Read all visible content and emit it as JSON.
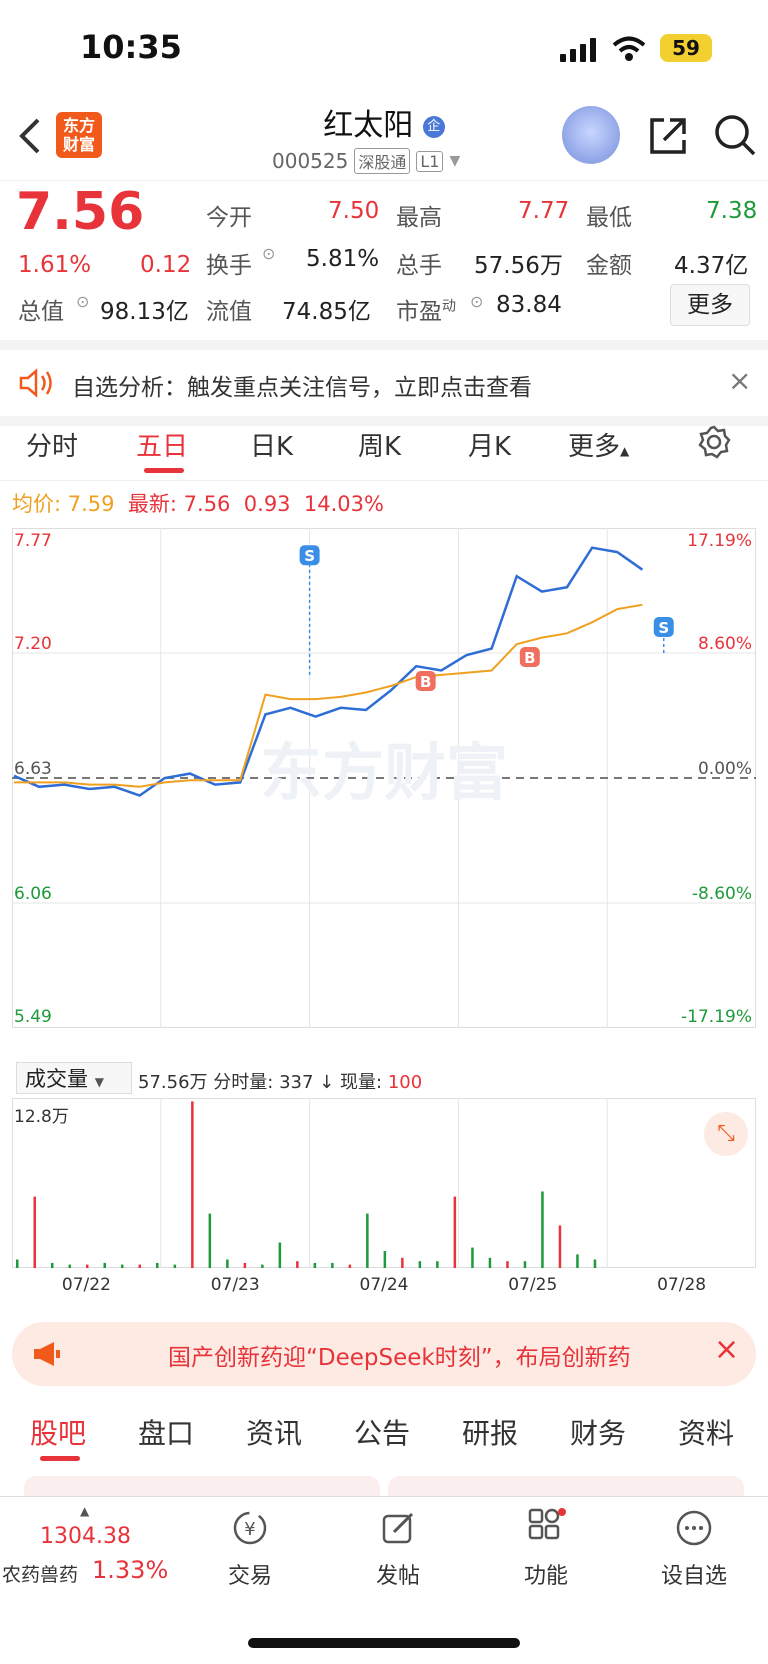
{
  "status": {
    "time": "10:35",
    "battery": "59"
  },
  "header": {
    "logo_text": "东方\n财富",
    "name": "红太阳",
    "code": "000525",
    "tag1": "深股通",
    "tag2": "L1"
  },
  "quote": {
    "price": "7.56",
    "pct": "1.61%",
    "chg": "0.12",
    "open_label": "今开",
    "open": "7.50",
    "high_label": "最高",
    "high": "7.77",
    "low_label": "最低",
    "low": "7.38",
    "turnover_label": "换手",
    "turnover": "5.81%",
    "vol_label": "总手",
    "vol": "57.56万",
    "amount_label": "金额",
    "amount": "4.37亿",
    "mktcap_label": "总值",
    "mktcap": "98.13亿",
    "float_label": "流值",
    "float": "74.85亿",
    "pe_label": "市盈",
    "pe_sup": "动",
    "pe": "83.84",
    "more": "更多"
  },
  "banner": {
    "text": "自选分析：触发重点关注信号，立即点击查看"
  },
  "tabs": [
    "分时",
    "五日",
    "日K",
    "周K",
    "月K",
    "更多"
  ],
  "info": {
    "avg_label": "均价:",
    "avg": "7.59",
    "last_label": "最新:",
    "last": "7.56",
    "chg": "0.93",
    "pct": "14.03%"
  },
  "chart_data": {
    "type": "line",
    "x": [
      "07/22",
      "07/23",
      "07/24",
      "07/25",
      "07/28"
    ],
    "ylim": [
      5.49,
      7.77
    ],
    "y_ticks": [
      "7.77",
      "7.20",
      "6.63",
      "6.06",
      "5.49"
    ],
    "pct_ticks": [
      "17.19%",
      "8.60%",
      "0.00%",
      "-8.60%",
      "-17.19%"
    ],
    "series": [
      {
        "values": [
          6.64,
          6.59,
          6.6,
          6.58,
          6.59,
          6.55,
          6.63,
          6.65,
          6.6,
          6.61,
          6.92,
          6.95,
          6.91,
          6.95,
          6.94,
          7.03,
          7.14,
          7.12,
          7.19,
          7.22,
          7.55,
          7.48,
          7.5,
          7.68,
          7.66,
          7.58
        ]
      },
      {
        "values": [
          6.61,
          6.61,
          6.61,
          6.6,
          6.6,
          6.59,
          6.61,
          6.62,
          6.62,
          6.62,
          7.01,
          6.99,
          6.99,
          7.0,
          7.02,
          7.05,
          7.09,
          7.1,
          7.11,
          7.12,
          7.24,
          7.27,
          7.29,
          7.34,
          7.4,
          7.42
        ]
      }
    ],
    "signals": [
      {
        "type": "B",
        "day": "07/24"
      },
      {
        "type": "S",
        "day": "07/24"
      },
      {
        "type": "B",
        "day": "07/25"
      },
      {
        "type": "S",
        "day": "07/28"
      }
    ],
    "watermark": "东方财富"
  },
  "volume": {
    "label": "成交量",
    "total": "57.56万",
    "fsl_label": "分时量:",
    "fsl": "337",
    "xl_label": "现量:",
    "xl": "100",
    "max": "12.8万"
  },
  "ad": {
    "text": "国产创新药迎“DeepSeek时刻”，布局创新药"
  },
  "subtabs": [
    "股吧",
    "盘口",
    "资讯",
    "公告",
    "研报",
    "财务",
    "资料"
  ],
  "bottom": {
    "index_value": "1304.38",
    "index_name": "农药兽药",
    "index_pct": "1.33%",
    "trade": "交易",
    "post": "发帖",
    "func": "功能",
    "watch": "设自选"
  }
}
